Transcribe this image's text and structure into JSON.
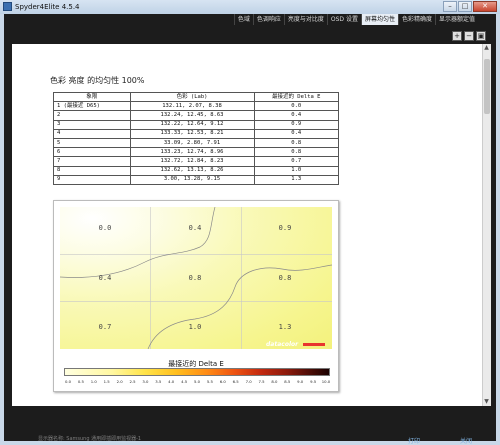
{
  "window": {
    "title": "Spyder4Elite 4.5.4",
    "buttons": {
      "minimize": "–",
      "maximize": "□",
      "close": "✕"
    }
  },
  "tabs": [
    {
      "label": "色域",
      "active": false
    },
    {
      "label": "色调响应",
      "active": false
    },
    {
      "label": "亮度与对比度",
      "active": false
    },
    {
      "label": "OSD 设置",
      "active": false
    },
    {
      "label": "屏幕均匀性",
      "active": true
    },
    {
      "label": "色彩精确度",
      "active": false
    },
    {
      "label": "显示器额定值",
      "active": false
    }
  ],
  "zoom_tools": [
    "search-plus-icon",
    "search-minus-icon",
    "fit-icon"
  ],
  "report": {
    "title": "色彩 亮度 的均匀性 100%",
    "table": {
      "headers": [
        "象限",
        "色彩 (Lab)",
        "最接近的 Delta E"
      ],
      "rows": [
        [
          "1 (最接近 D65)",
          "132.11,   2.07,   8.38",
          "0.0"
        ],
        [
          "2",
          "132.24,  12.45,   8.63",
          "0.4"
        ],
        [
          "3",
          "132.22,  12.64,   9.12",
          "0.9"
        ],
        [
          "4",
          "133.33,  12.53,   8.21",
          "0.4"
        ],
        [
          "5",
          " 33.09,   2.80,   7.91",
          "0.8"
        ],
        [
          "6",
          "133.23,  12.74,   8.96",
          "0.8"
        ],
        [
          "7",
          "132.72,  12.84,   8.23",
          "0.7"
        ],
        [
          "8",
          "132.62,  13.13,   8.26",
          "1.0"
        ],
        [
          "9",
          "  3.00,  13.28,   9.15",
          "1.3"
        ]
      ]
    },
    "heatmap": {
      "cells": [
        "0.0",
        "0.4",
        "0.9",
        "0.4",
        "0.8",
        "0.8",
        "0.7",
        "1.0",
        "1.3"
      ],
      "brand": "datacolor",
      "brand_color": "#e8352e",
      "legend_title": "最接近的 Delta E",
      "legend_ticks": [
        "0.0",
        "0.5",
        "1.0",
        "1.5",
        "2.0",
        "2.5",
        "3.0",
        "3.5",
        "4.0",
        "4.5",
        "5.0",
        "5.5",
        "6.0",
        "6.5",
        "7.0",
        "7.5",
        "8.0",
        "8.5",
        "9.0",
        "9.5",
        "10.0"
      ]
    }
  },
  "chart_data": {
    "type": "heatmap",
    "title": "",
    "rows": 3,
    "cols": 3,
    "values": [
      [
        0.0,
        0.4,
        0.9
      ],
      [
        0.4,
        0.8,
        0.8
      ],
      [
        0.7,
        1.0,
        1.3
      ]
    ],
    "legend_title": "最接近的 Delta E",
    "scale_range": [
      0.0,
      10.0
    ],
    "grid": true
  },
  "footer": {
    "display_name": "显示器名称: Samsung 通用即插即用监视器-1",
    "print_label": "打印",
    "close_label": "关闭"
  }
}
